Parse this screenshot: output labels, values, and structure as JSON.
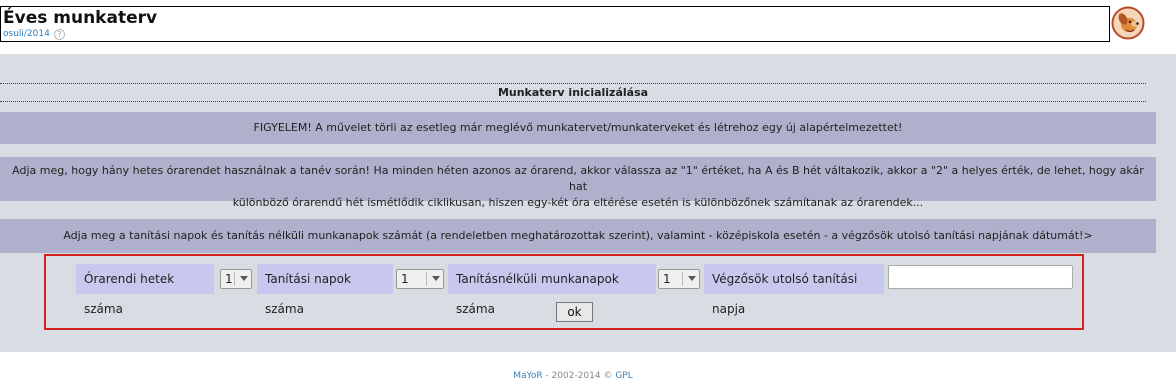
{
  "header": {
    "title": "Éves munkaterv",
    "session_link": "osuli/2014",
    "help_symbol": "?",
    "logo_icon": "mayor-dog-logo"
  },
  "main": {
    "section_title": "Munkaterv inicializálása",
    "warning": "FIGYELEM! A művelet törli az esetleg már meglévő munkatervet/munkaterveket és létrehoz egy új alapértelmezettet!",
    "desc_week_line1": "Adja meg, hogy hány hetes órarendet használnak a tanév során! Ha minden héten azonos az órarend, akkor válassza az \"1\" értéket, ha A és B hét váltakozik, akkor a \"2\" a helyes érték, de lehet, hogy akár hat",
    "desc_week_line2": "különböző órarendű hét ismétlődik ciklikusan, hiszen egy-két óra eltérése esetén is különbözőnek számítanak az órarendek...",
    "desc_days": "Adja meg a tanítási napok és tanítás nélküli munkanapok számát (a rendeletben meghatározottak szerint), valamint - középiskola esetén - a végzősök utolsó tanítási napjának dátumát!>"
  },
  "form": {
    "weeks_label": "Órarendi hetek száma",
    "weeks_value": "1",
    "teaching_days_label": "Tanítási napok száma",
    "teaching_days_value": "1",
    "workdays_label": "Tanításnélküli munkanapok száma",
    "workdays_value": "1",
    "last_day_label": "Végzősök utolsó tanítási napja",
    "last_day_value": "",
    "ok_label": "ok"
  },
  "footer": {
    "brand": "MaYoR",
    "years": " - 2002-2014 © ",
    "license": "GPL"
  },
  "colors": {
    "main_bg": "#d7dde3",
    "info_bg": "#b0b0cc",
    "label_bg": "#c8c8ef",
    "highlight_border": "#d51e1e",
    "link": "#2a7fc4"
  }
}
